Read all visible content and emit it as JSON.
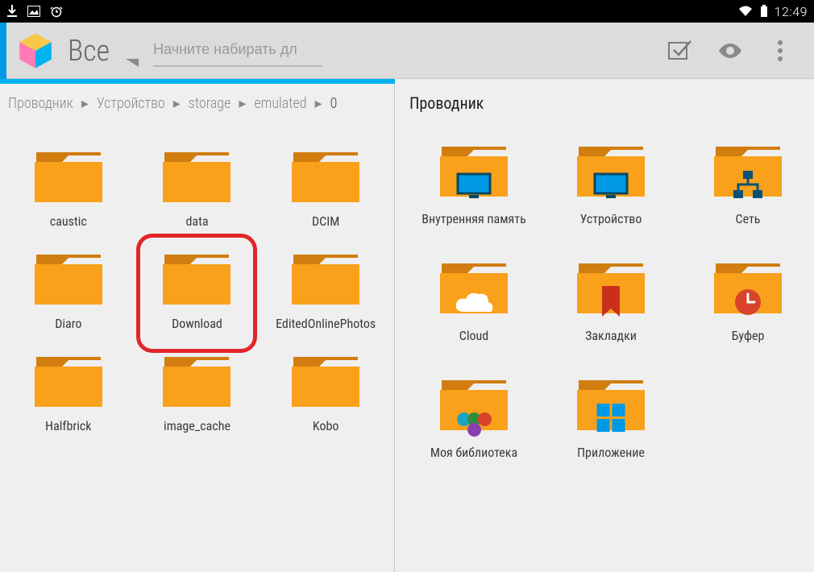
{
  "status": {
    "time": "12:49"
  },
  "appbar": {
    "title": "Все",
    "search_placeholder": "Начните набирать дл"
  },
  "breadcrumb": {
    "items": [
      "Проводник",
      "Устройство",
      "storage",
      "emulated",
      "0"
    ]
  },
  "left_grid": {
    "items": [
      {
        "label": "caustic",
        "type": "folder"
      },
      {
        "label": "data",
        "type": "folder"
      },
      {
        "label": "DCIM",
        "type": "folder"
      },
      {
        "label": "Diaro",
        "type": "folder"
      },
      {
        "label": "Download",
        "type": "folder",
        "highlighted": true
      },
      {
        "label": "EditedOnlinePhotos",
        "type": "folder"
      },
      {
        "label": "Halfbrick",
        "type": "folder"
      },
      {
        "label": "image_cache",
        "type": "folder"
      },
      {
        "label": "Kobo",
        "type": "folder"
      }
    ]
  },
  "right": {
    "title": "Проводник",
    "items": [
      {
        "label": "Внутренняя память",
        "type": "folder-storage"
      },
      {
        "label": "Устройство",
        "type": "folder-device"
      },
      {
        "label": "Сеть",
        "type": "folder-network"
      },
      {
        "label": "Cloud",
        "type": "folder-cloud"
      },
      {
        "label": "Закладки",
        "type": "folder-bookmark"
      },
      {
        "label": "Буфер",
        "type": "folder-clock"
      },
      {
        "label": "Моя библиотека",
        "type": "folder-library"
      },
      {
        "label": "Приложение",
        "type": "folder-apps"
      }
    ]
  },
  "colors": {
    "accent_blue": "#00b3ee",
    "folder_orange": "#f9a11b",
    "folder_dark": "#d17d0f",
    "highlight_red": "#e2252a"
  }
}
